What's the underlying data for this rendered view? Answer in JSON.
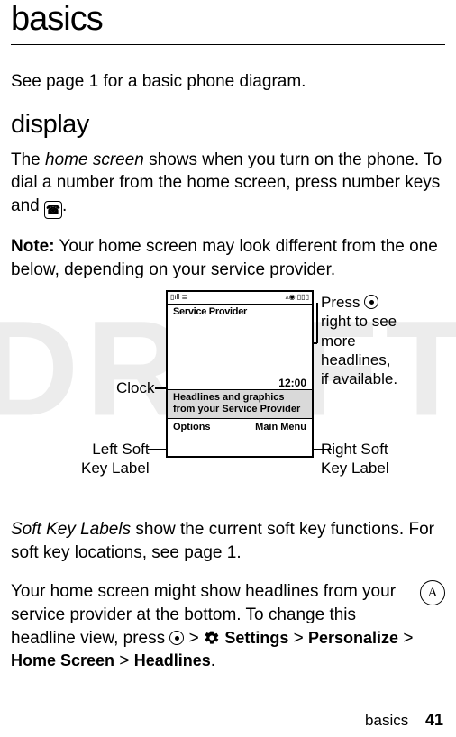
{
  "title": "basics",
  "intro": "See page 1 for a basic phone diagram.",
  "section_heading": "display",
  "para1_prefix": "The ",
  "para1_italic": "home screen",
  "para1_rest": " shows when you turn on the phone. To dial a number from the home screen, press number keys and ",
  "para1_after_icon": ".",
  "dial_key_glyph": "☎",
  "note_label": "Note:",
  "note_text": " Your home screen may look different from the one below, depending on your service provider.",
  "phone": {
    "status_left": "▯ıll ≣",
    "status_right": "▵◉ ▯▯▯",
    "service_provider": "Service Provider",
    "clock": "12:00",
    "headlines": "Headlines and graphics from your Service Provider",
    "left_softkey": "Options",
    "right_softkey": "Main Menu"
  },
  "callouts": {
    "clock": "Clock",
    "leftsoft_l1": "Left Soft",
    "leftsoft_l2": "Key Label",
    "rightsoft_l1": "Right Soft",
    "rightsoft_l2": "Key Label",
    "press_pre": "Press ",
    "press_post1": "right to see",
    "press_post2": "more",
    "press_post3": "headlines,",
    "press_post4": "if available."
  },
  "para_softkeys_italic": "Soft Key Labels",
  "para_softkeys_rest": " show the current soft key functions. For soft key locations, see page 1.",
  "para_headlines_text": "Your home screen might show headlines from your service provider at the bottom. To change this headline view, press ",
  "path_settings": "Settings",
  "path_personalize": "Personalize",
  "path_homescreen": "Home Screen",
  "path_headlines": "Headlines",
  "sep": " > ",
  "settings_glyph": "⚙",
  "a_badge": "A",
  "footer_label": "basics",
  "footer_page": "41"
}
